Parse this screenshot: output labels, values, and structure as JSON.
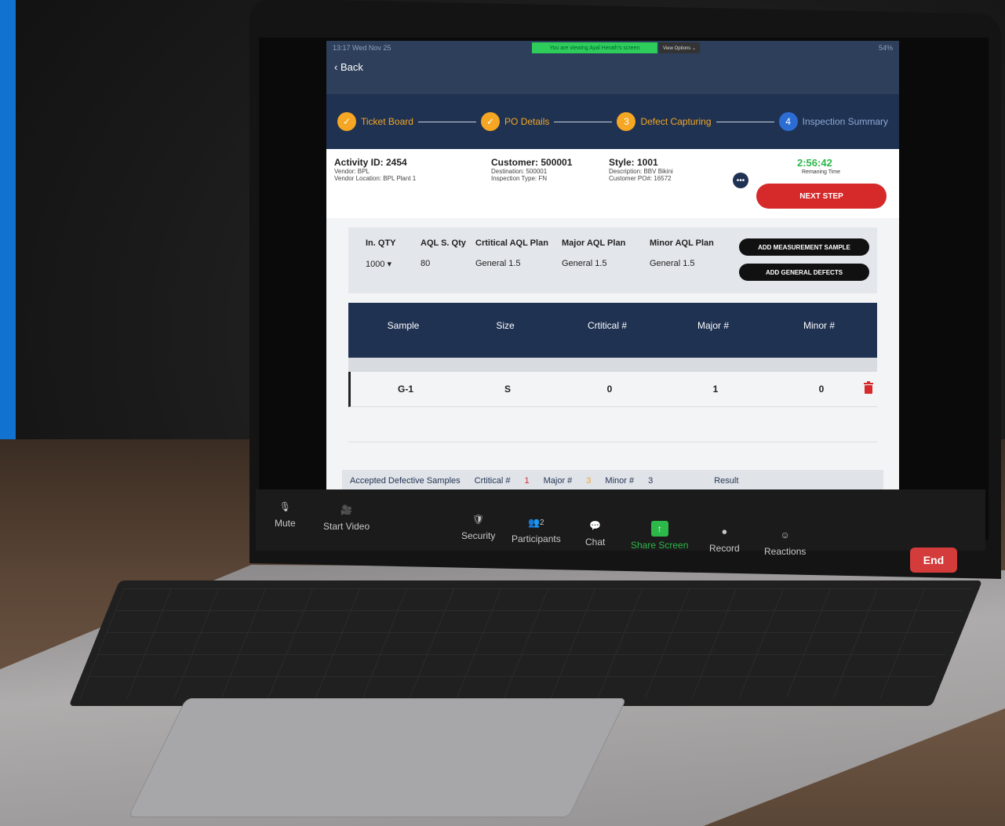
{
  "status": {
    "time": "13:17  Wed Nov 25",
    "battery": "54%"
  },
  "share_banner": {
    "text": "You are viewing Ayal Herath's screen",
    "view_options": "View Options ⌄"
  },
  "nav": {
    "back_label": "Back"
  },
  "steps": [
    {
      "label": "Ticket Board",
      "marker": "✓"
    },
    {
      "label": "PO Details",
      "marker": "✓"
    },
    {
      "label": "Defect Capturing",
      "marker": "3"
    },
    {
      "label": "Inspection Summary",
      "marker": "4"
    }
  ],
  "activity": {
    "id": "Activity ID: 2454",
    "vendor": "Vendor: BPL",
    "vendor_location": "Vendor Location: BPL Plant 1",
    "customer": "Customer: 500001",
    "destination": "Destination: 500001",
    "inspection_type": "Inspection Type: FN",
    "style": "Style: 1001",
    "description": "Description: BBV Bikini",
    "customer_po": "Customer PO#: 16572",
    "timer": "2:56:42",
    "timer_label": "Remaning Time",
    "next_step": "NEXT STEP"
  },
  "aql": {
    "in_qty_label": "In. QTY",
    "in_qty_value": "1000",
    "sample_qty_label": "AQL S. Qty",
    "sample_qty_value": "80",
    "critical_label": "Crtitical AQL Plan",
    "critical_value": "General 1.5",
    "major_label": "Major AQL Plan",
    "major_value": "General 1.5",
    "minor_label": "Minor AQL Plan",
    "minor_value": "General 1.5",
    "add_measurement": "ADD MEASUREMENT SAMPLE",
    "add_general": "ADD GENERAL DEFECTS"
  },
  "table": {
    "headers": [
      "Sample",
      "Size",
      "Crtitical #",
      "Major #",
      "Minor #"
    ],
    "rows": [
      {
        "sample": "G-1",
        "size": "S",
        "critical": "0",
        "major": "1",
        "minor": "0"
      }
    ]
  },
  "summary": {
    "label": "Accepted Defective Samples",
    "critical_label": "Crtitical #",
    "critical_value": "1",
    "major_label": "Major #",
    "major_value": "3",
    "minor_label": "Minor #",
    "minor_value": "3",
    "result_label": "Result"
  },
  "zoom": {
    "mute": "Mute",
    "start_video": "Start Video",
    "security": "Security",
    "participants": "Participants",
    "participants_count": "2",
    "chat": "Chat",
    "share_screen": "Share Screen",
    "record": "Record",
    "reactions": "Reactions",
    "end": "End"
  },
  "colors": {
    "accent": "#f5a623",
    "navy": "#1f3252",
    "danger": "#d62a2a",
    "zoom_green": "#2db84a"
  }
}
